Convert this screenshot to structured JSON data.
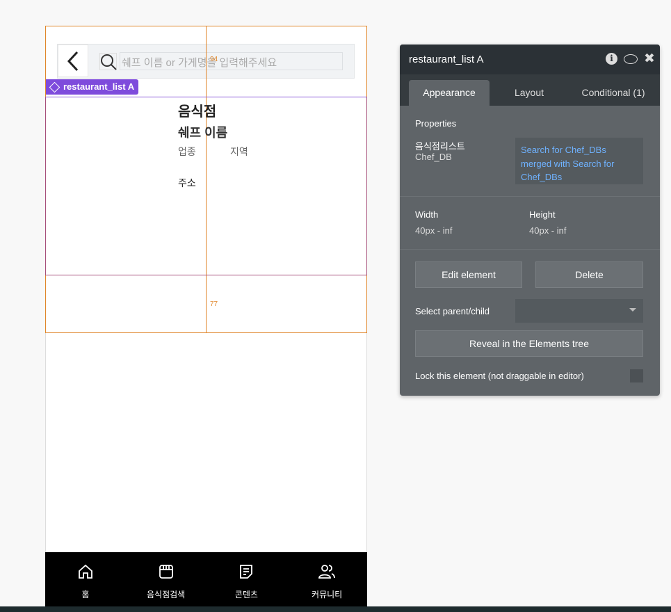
{
  "canvas": {
    "search_placeholder": "쉐프 이름 or 가게명을 입력해주세요",
    "dim_top": "94",
    "dim_bottom": "77",
    "element_tag": "restaurant_list A",
    "cell": {
      "restaurant": "음식점",
      "chef": "쉐프 이름",
      "category": "업종",
      "region": "지역",
      "address": "주소"
    },
    "nav": [
      {
        "label": "홈",
        "icon": "home-icon"
      },
      {
        "label": "음식점검색",
        "icon": "store-icon"
      },
      {
        "label": "콘텐츠",
        "icon": "document-icon"
      },
      {
        "label": "커뮤니티",
        "icon": "community-icon"
      }
    ]
  },
  "panel": {
    "title": "restaurant_list A",
    "tabs": [
      "Appearance",
      "Layout",
      "Conditional (1)"
    ],
    "properties_label": "Properties",
    "prop_name": "음식점리스트",
    "prop_type": "Chef_DB",
    "prop_value": "Search for Chef_DBs merged with Search for Chef_DBs",
    "width_label": "Width",
    "width_value": "40px - inf",
    "height_label": "Height",
    "height_value": "40px - inf",
    "edit_label": "Edit element",
    "delete_label": "Delete",
    "select_parent_label": "Select parent/child",
    "reveal_label": "Reveal in the Elements tree",
    "lock_label": "Lock this element (not draggable in editor)"
  },
  "colors": {
    "accent": "#7e4bdc",
    "guide": "#e0862a",
    "link": "#6fb2ff"
  }
}
